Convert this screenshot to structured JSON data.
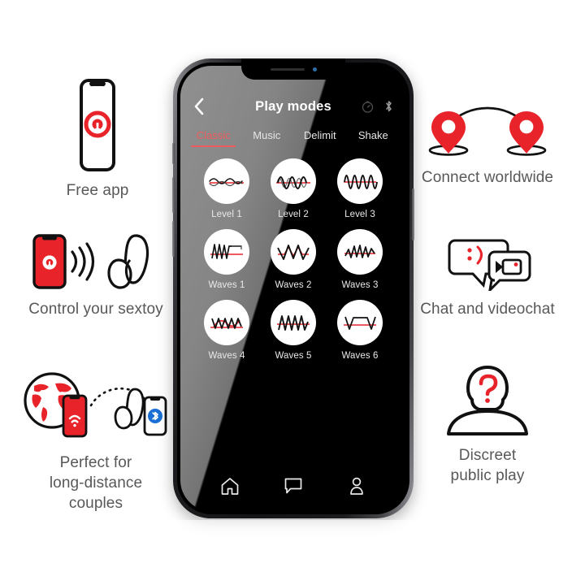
{
  "brand": {
    "red": "#e8242a",
    "accent_red": "#ef5a5a",
    "text_gray": "#58585a",
    "bluetooth_blue": "#1a6fd4"
  },
  "features": {
    "free_app": {
      "caption": "Free app",
      "icon": "phone-with-app-logo-icon"
    },
    "control": {
      "caption": "Control your sextoy",
      "icon": "phone-signal-toy-icon"
    },
    "long_distance": {
      "caption_line1": "Perfect for",
      "caption_line2": "long-distance",
      "caption_line3": "couples",
      "icon": "globe-phone-bluetooth-icon"
    },
    "connect": {
      "caption": "Connect worldwide",
      "icon": "two-map-pins-arc-icon"
    },
    "chat": {
      "caption": "Chat and videochat",
      "icon": "speech-bubble-videocam-icon",
      "emoticon": ";)"
    },
    "discreet": {
      "caption_line1": "Discreet",
      "caption_line2": "public play",
      "icon": "person-question-mark-icon"
    }
  },
  "phone": {
    "topbar": {
      "back_icon": "chevron-left-icon",
      "title": "Play modes",
      "timer_icon": "timer-gauge-icon",
      "bluetooth_icon": "bluetooth-icon"
    },
    "tabs": [
      {
        "label": "Classic",
        "active": true
      },
      {
        "label": "Music",
        "active": false
      },
      {
        "label": "Delimit",
        "active": false
      },
      {
        "label": "Shake",
        "active": false
      }
    ],
    "modes": [
      {
        "label": "Level 1",
        "wave": "sine-low"
      },
      {
        "label": "Level 2",
        "wave": "sine-medium"
      },
      {
        "label": "Level 3",
        "wave": "sine-high"
      },
      {
        "label": "Waves 1",
        "wave": "spike-then-flat"
      },
      {
        "label": "Waves 2",
        "wave": "v-peaks"
      },
      {
        "label": "Waves 3",
        "wave": "jagged-mixed"
      },
      {
        "label": "Waves 4",
        "wave": "zigzag-arc"
      },
      {
        "label": "Waves 5",
        "wave": "triangle-saw"
      },
      {
        "label": "Waves 6",
        "wave": "v-trapezoid"
      }
    ],
    "navbar": [
      {
        "icon": "home-icon",
        "label": "Home"
      },
      {
        "icon": "chat-bubble-icon",
        "label": "Chat"
      },
      {
        "icon": "profile-person-icon",
        "label": "Profile"
      }
    ]
  }
}
